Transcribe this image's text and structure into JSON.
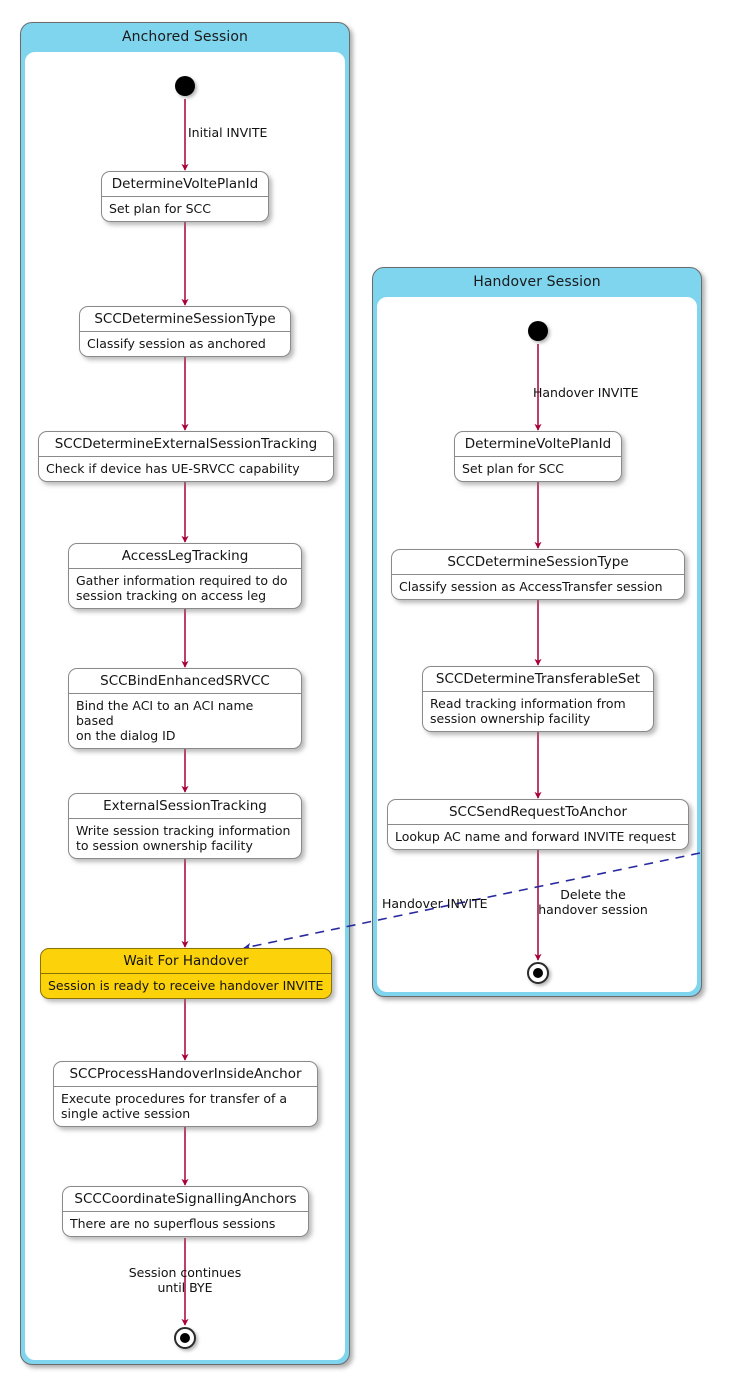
{
  "diagram": {
    "type": "uml-state-diagram",
    "colors": {
      "composite_header": "#7FD4EE",
      "composite_border": "#6B6B6B",
      "node_fill": "#FFFFFF",
      "node_border": "#8A8A8A",
      "highlight_fill": "#FCD20B",
      "arrow": "#A80036",
      "cross_arrow": "#2A2AA0",
      "background": "#FFFFFF"
    },
    "composites": [
      {
        "id": "anchored",
        "title": "Anchored Session"
      },
      {
        "id": "handover",
        "title": "Handover Session"
      }
    ]
  },
  "anchored_session": {
    "title": "Anchored Session",
    "start_label": "start-state",
    "end_label": "end-state",
    "transitions": {
      "initial": "Initial INVITE",
      "final_line1": "Session continues",
      "final_line2": "until BYE"
    },
    "states": [
      {
        "name": "DetermineVoltePlanId",
        "description": "Set plan for SCC",
        "highlight": false
      },
      {
        "name": "SCCDetermineSessionType",
        "description": "Classify session as anchored",
        "highlight": false
      },
      {
        "name": "SCCDetermineExternalSessionTracking",
        "description": "Check if device has UE-SRVCC capability",
        "highlight": false
      },
      {
        "name": "AccessLegTracking",
        "description": "Gather information required to do\nsession tracking on access leg",
        "highlight": false
      },
      {
        "name": "SCCBindEnhancedSRVCC",
        "description": "Bind the ACI to an ACI name based\non the dialog ID",
        "highlight": false
      },
      {
        "name": "ExternalSessionTracking",
        "description": "Write session tracking information\nto session ownership facility",
        "highlight": false
      },
      {
        "name": "Wait For Handover",
        "description": "Session is ready to receive handover INVITE",
        "highlight": true
      },
      {
        "name": "SCCProcessHandoverInsideAnchor",
        "description": "Execute procedures for transfer of a\nsingle active session",
        "highlight": false
      },
      {
        "name": "SCCCoordinateSignallingAnchors",
        "description": "There are no superflous sessions",
        "highlight": false
      }
    ]
  },
  "handover_session": {
    "title": "Handover Session",
    "start_label": "start-state",
    "end_label": "end-state",
    "transitions": {
      "initial": "Handover INVITE",
      "final_line1": "Delete the",
      "final_line2": "handover session",
      "cross_to_anchor": "Handover INVITE"
    },
    "states": [
      {
        "name": "DetermineVoltePlanId",
        "description": "Set plan for SCC",
        "highlight": false
      },
      {
        "name": "SCCDetermineSessionType",
        "description": "Classify session as AccessTransfer session",
        "highlight": false
      },
      {
        "name": "SCCDetermineTransferableSet",
        "description": "Read tracking information from\nsession ownership facility",
        "highlight": false
      },
      {
        "name": "SCCSendRequestToAnchor",
        "description": "Lookup AC name and forward INVITE request",
        "highlight": false
      }
    ]
  }
}
